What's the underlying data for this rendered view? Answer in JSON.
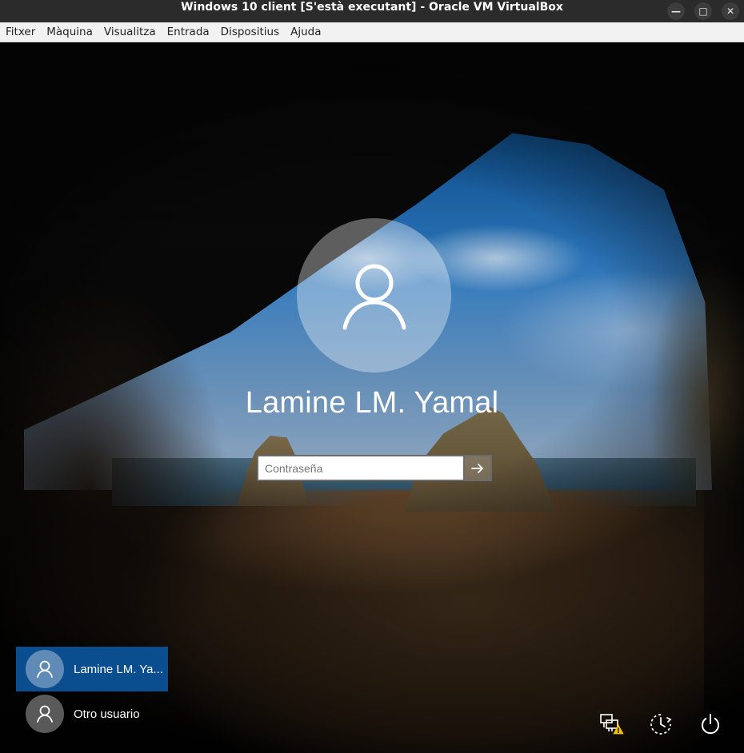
{
  "window": {
    "title": "Windows 10 client  [S'està executant] - Oracle VM VirtualBox",
    "controls": [
      "minimize-icon",
      "maximize-icon",
      "close-icon"
    ]
  },
  "menu": {
    "items": [
      "Fitxer",
      "Màquina",
      "Visualitza",
      "Entrada",
      "Dispositius",
      "Ajuda"
    ]
  },
  "login": {
    "username": "Lamine LM. Yamal",
    "password_placeholder": "Contraseña",
    "submit_icon": "arrow-right-icon"
  },
  "users": [
    {
      "label": "Lamine LM. Ya...",
      "active": true,
      "icon": "user-icon"
    },
    {
      "label": "Otro usuario",
      "active": false,
      "icon": "user-icon"
    }
  ],
  "system_icons": [
    "network-warning-icon",
    "ease-of-access-icon",
    "power-icon"
  ],
  "colors": {
    "selected_user": "#0a4e8f",
    "accent_white": "#ffffff"
  }
}
